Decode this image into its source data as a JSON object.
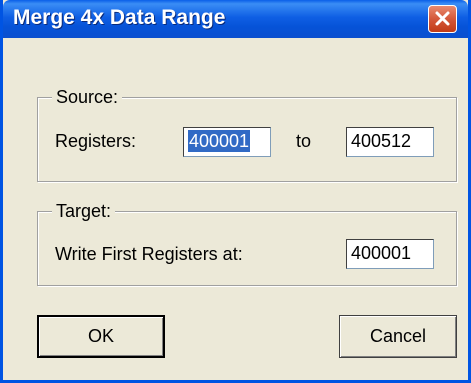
{
  "dialog": {
    "title": "Merge 4x Data Range",
    "close_icon": "close-icon"
  },
  "source": {
    "group_label": "Source:",
    "registers_label": "Registers:",
    "from_value": "400001",
    "to_label": "to",
    "to_value": "400512"
  },
  "target": {
    "group_label": "Target:",
    "write_label": "Write First Registers at:",
    "write_value": "400001"
  },
  "buttons": {
    "ok_label": "OK",
    "cancel_label": "Cancel"
  },
  "colors": {
    "titlebar": "#0a5fe8",
    "selection": "#316ac5",
    "close_button": "#d4583a",
    "dialog_bg": "#ece9d8"
  }
}
